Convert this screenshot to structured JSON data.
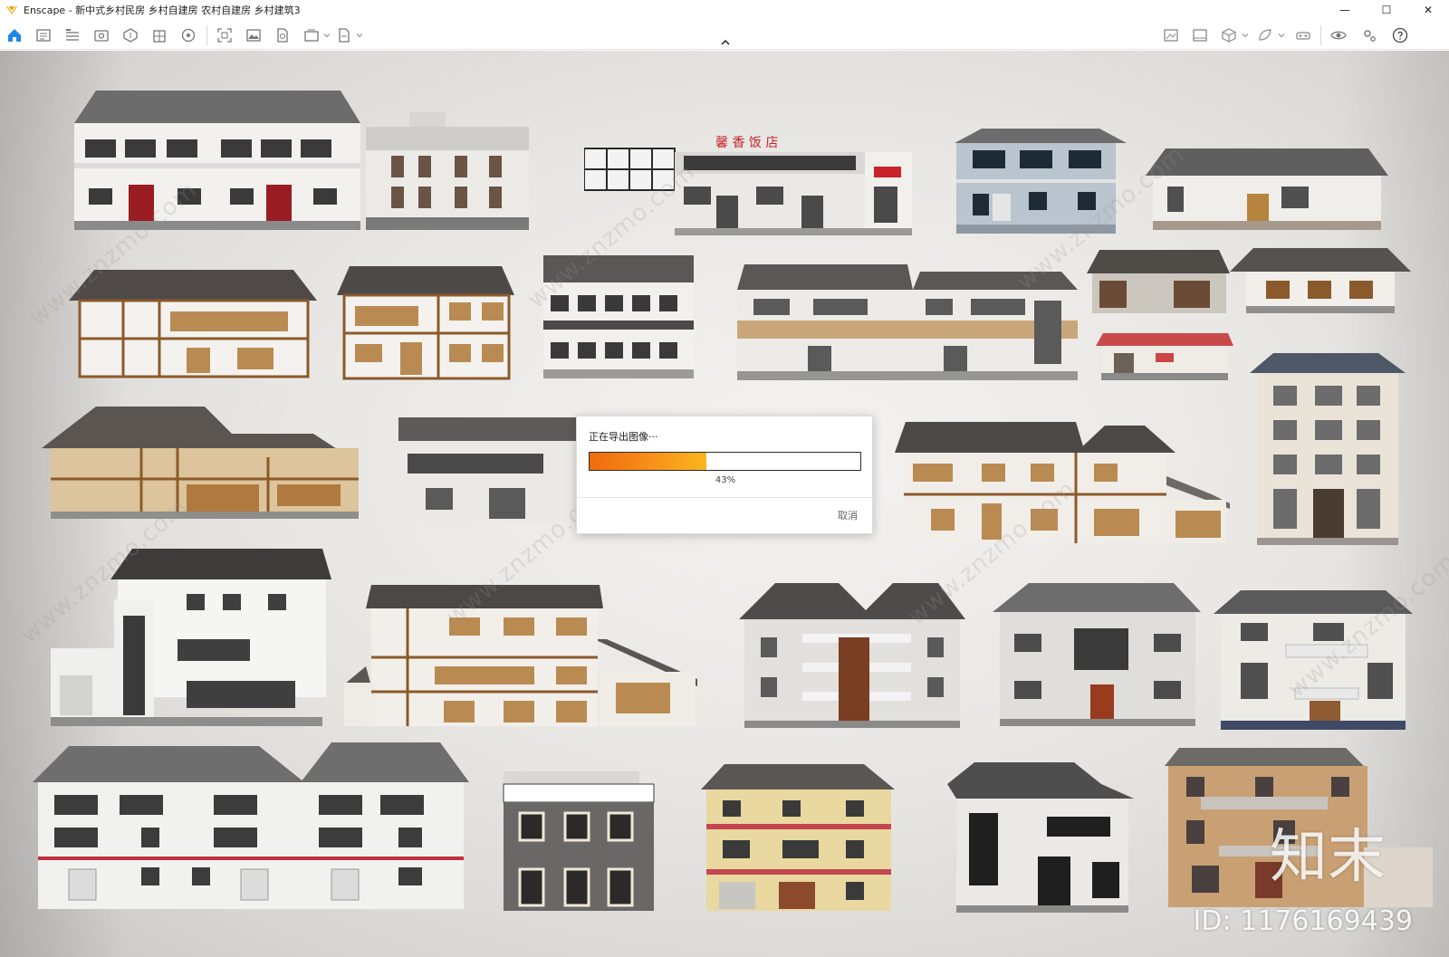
{
  "window": {
    "title": "Enscape - 新中式乡村民房 乡村自建房 农村自建房 乡村建筑3",
    "minimize": "—",
    "maximize": "☐",
    "close": "✕"
  },
  "toolbar": {
    "left_icons": [
      "home-icon",
      "views-icon",
      "bim-icon",
      "visual-settings-icon",
      "asset-library-icon",
      "sun-study-icon",
      "material-editor-icon",
      "screenshot-icon",
      "render-icon",
      "export-web-icon",
      "batch-render-icon",
      "exe-export-icon"
    ],
    "right_icons": [
      "capture-icon",
      "image-icon",
      "cube-icon",
      "feedback-icon",
      "vr-icon",
      "eye-icon",
      "settings-icon",
      "help-icon"
    ]
  },
  "dialog": {
    "title": "正在导出图像···",
    "progress": 0.43,
    "progress_text": "43%",
    "cancel": "取消"
  },
  "overlay": {
    "watermark": "www.znzmo.com",
    "logo_text": "知末",
    "id_text": "ID: 1176169439"
  },
  "scene": {
    "restaurant_sign": "馨 香 饭 店"
  },
  "colors": {
    "accent_orange": "#f38a14",
    "home_icon_blue": "#1e88e5"
  }
}
